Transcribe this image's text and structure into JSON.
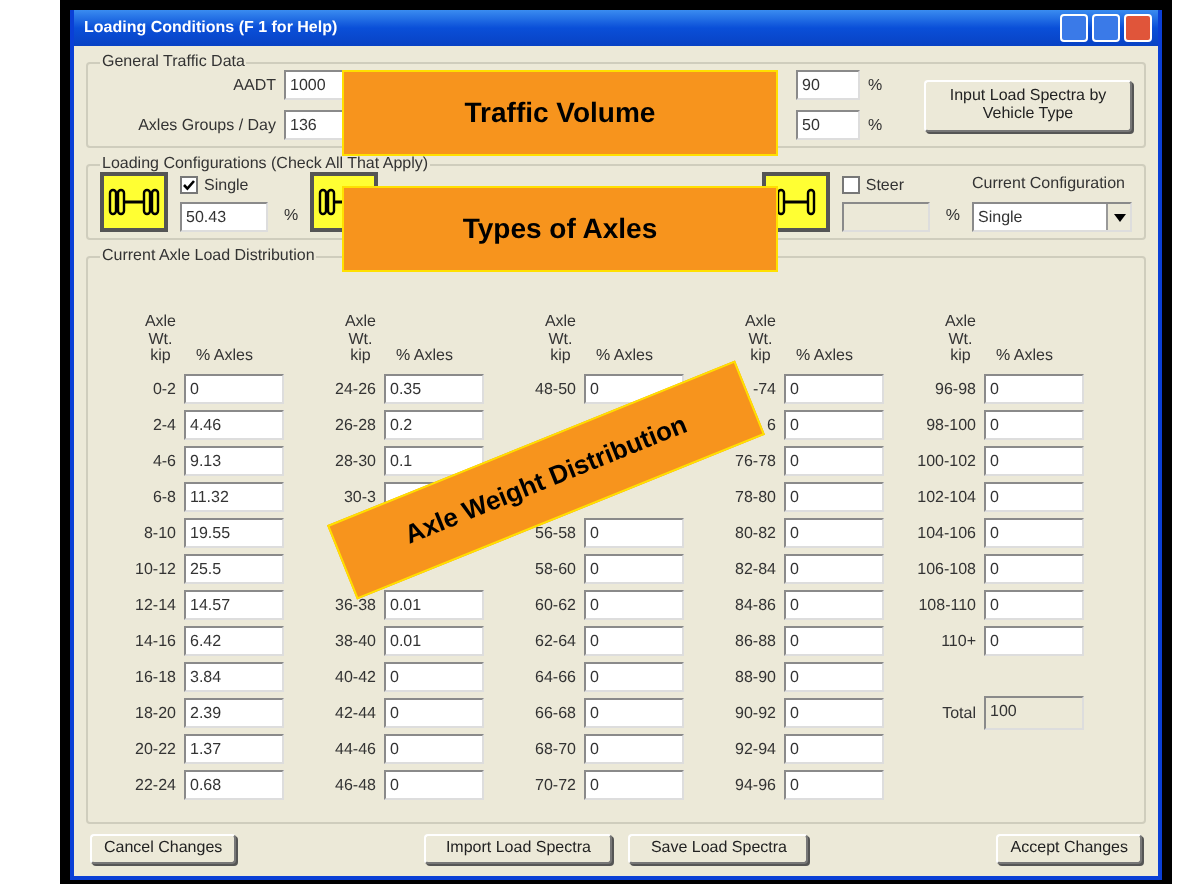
{
  "window": {
    "title": "Loading Conditions (F 1 for Help)"
  },
  "general_traffic": {
    "title": "General Traffic Data",
    "fields": [
      {
        "label": "AADT",
        "value": "1000"
      },
      {
        "label": "Axles Groups / Day",
        "value": "136"
      }
    ],
    "right_fields": [
      {
        "value": "90",
        "unit": "%"
      },
      {
        "value": "50",
        "unit": "%"
      }
    ],
    "button": "Input Load Spectra by Vehicle Type"
  },
  "loading_configurations": {
    "title": "Loading Configurations (Check All That Apply)",
    "configs": [
      {
        "kind": "single",
        "label": "Single",
        "checked": true,
        "disabled": false,
        "value": "50.43",
        "unit": "%"
      },
      {
        "kind": "tandem"
      },
      {
        "kind": "steer",
        "label": "Steer",
        "checked": false,
        "disabled": true,
        "unit": "%"
      }
    ],
    "current_configuration": {
      "label": "Current Configuration",
      "value": "Single"
    }
  },
  "distribution": {
    "title": "Current Axle Load Distribution",
    "columns": [
      {
        "header_label": "Axle Wt. kip",
        "header_value": "% Axles",
        "rows": [
          {
            "label": "0-2",
            "value": "0"
          },
          {
            "label": "2-4",
            "value": "4.46"
          },
          {
            "label": "4-6",
            "value": "9.13"
          },
          {
            "label": "6-8",
            "value": "11.32"
          },
          {
            "label": "8-10",
            "value": "19.55"
          },
          {
            "label": "10-12",
            "value": "25.5"
          },
          {
            "label": "12-14",
            "value": "14.57"
          },
          {
            "label": "14-16",
            "value": "6.42"
          },
          {
            "label": "16-18",
            "value": "3.84"
          },
          {
            "label": "18-20",
            "value": "2.39"
          },
          {
            "label": "20-22",
            "value": "1.37"
          },
          {
            "label": "22-24",
            "value": "0.68"
          }
        ]
      },
      {
        "header_label": "Axle Wt. kip",
        "header_value": "% Axles",
        "rows": [
          {
            "label": "24-26",
            "value": "0.35"
          },
          {
            "label": "26-28",
            "value": "0.2"
          },
          {
            "label": "28-30",
            "value": "0.1"
          },
          {
            "label": "30-3"
          },
          {},
          {},
          {
            "label": "36-38",
            "value": "0.01"
          },
          {
            "label": "38-40",
            "value": "0.01"
          },
          {
            "label": "40-42",
            "value": "0"
          },
          {
            "label": "42-44",
            "value": "0"
          },
          {
            "label": "44-46",
            "value": "0"
          },
          {
            "label": "46-48",
            "value": "0"
          }
        ]
      },
      {
        "header_label": "Axle Wt. kip",
        "header_value": "% Axles",
        "rows": [
          {
            "label": "48-50",
            "value": "0"
          },
          {},
          {},
          {},
          {
            "label": "56-58",
            "value": "0"
          },
          {
            "label": "58-60",
            "value": "0"
          },
          {
            "label": "60-62",
            "value": "0"
          },
          {
            "label": "62-64",
            "value": "0"
          },
          {
            "label": "64-66",
            "value": "0"
          },
          {
            "label": "66-68",
            "value": "0"
          },
          {
            "label": "68-70",
            "value": "0"
          },
          {
            "label": "70-72",
            "value": "0"
          }
        ]
      },
      {
        "header_label": "Axle Wt. kip",
        "header_value": "% Axles",
        "rows": [
          {
            "label": "-74",
            "value": "0"
          },
          {
            "label": "6",
            "value": "0"
          },
          {
            "label": "76-78",
            "value": "0"
          },
          {
            "label": "78-80",
            "value": "0"
          },
          {
            "label": "80-82",
            "value": "0"
          },
          {
            "label": "82-84",
            "value": "0"
          },
          {
            "label": "84-86",
            "value": "0"
          },
          {
            "label": "86-88",
            "value": "0"
          },
          {
            "label": "88-90",
            "value": "0"
          },
          {
            "label": "90-92",
            "value": "0"
          },
          {
            "label": "92-94",
            "value": "0"
          },
          {
            "label": "94-96",
            "value": "0"
          }
        ]
      },
      {
        "header_label": "Axle Wt. kip",
        "header_value": "% Axles",
        "rows": [
          {
            "label": "96-98",
            "value": "0"
          },
          {
            "label": "98-100",
            "value": "0"
          },
          {
            "label": "100-102",
            "value": "0"
          },
          {
            "label": "102-104",
            "value": "0"
          },
          {
            "label": "104-106",
            "value": "0"
          },
          {
            "label": "106-108",
            "value": "0"
          },
          {
            "label": "108-110",
            "value": "0"
          },
          {
            "label": "110+",
            "value": "0"
          }
        ]
      }
    ],
    "total": {
      "label": "Total",
      "value": "100"
    }
  },
  "buttons": [
    {
      "label": "Cancel Changes"
    },
    {
      "label": "Import Load Spectra"
    },
    {
      "label": "Save Load Spectra"
    },
    {
      "label": "Accept Changes"
    }
  ],
  "callouts": [
    {
      "text": "Traffic Volume",
      "kind": "box"
    },
    {
      "text": "Types of Axles",
      "kind": "box"
    },
    {
      "text": "Axle Weight Distribution",
      "kind": "banner"
    }
  ]
}
